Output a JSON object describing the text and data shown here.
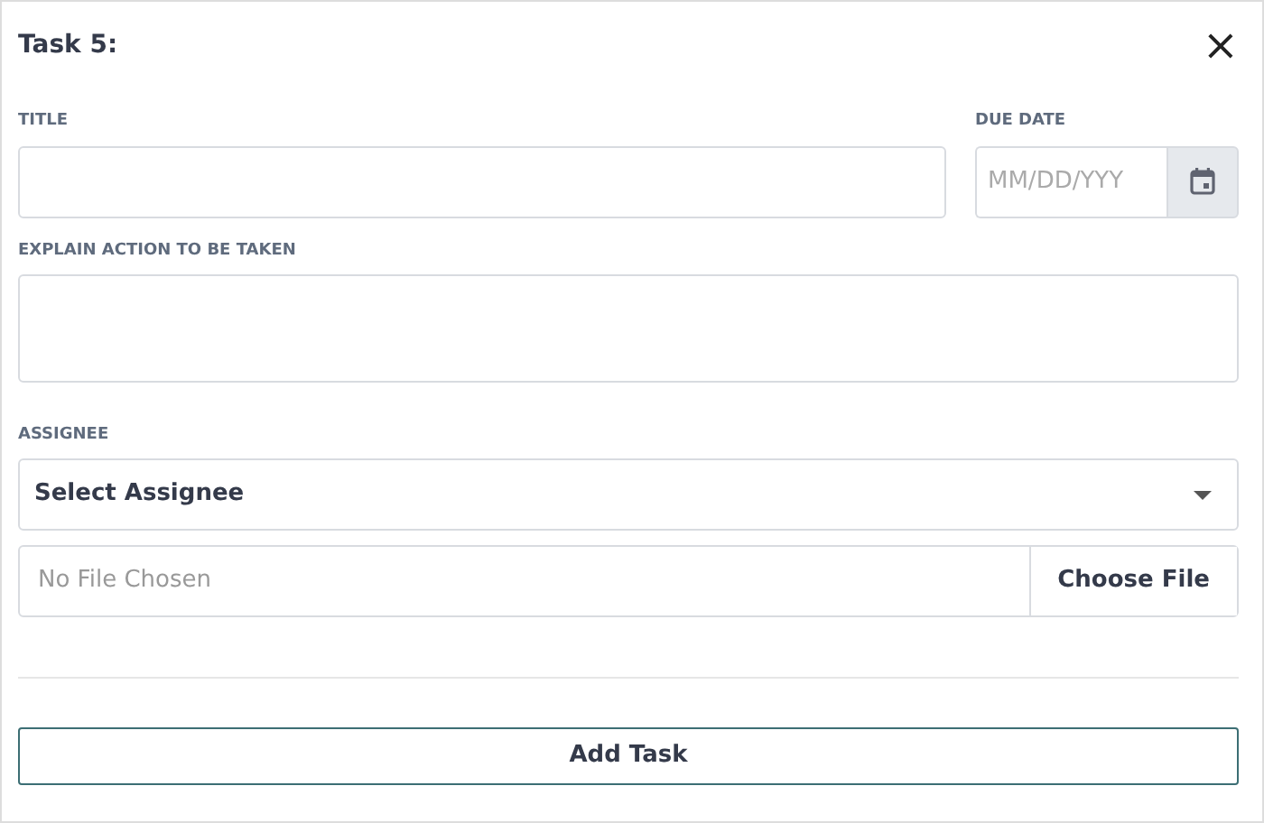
{
  "dialog": {
    "title": "Task 5:",
    "close": "×"
  },
  "fields": [
    {
      "kind": "text",
      "label": "TITLE"
    },
    {
      "kind": "date",
      "label": "DUE DATE",
      "placeholder": "MM/DD/YYY"
    },
    {
      "kind": "textarea",
      "label": "EXPLAIN ACTION TO BE TAKEN"
    },
    {
      "kind": "select",
      "label": "ASSIGNEE",
      "value": "Select Assignee"
    },
    {
      "kind": "file",
      "value": "No File Chosen",
      "button": "Choose File"
    }
  ],
  "submit": "Add Task"
}
